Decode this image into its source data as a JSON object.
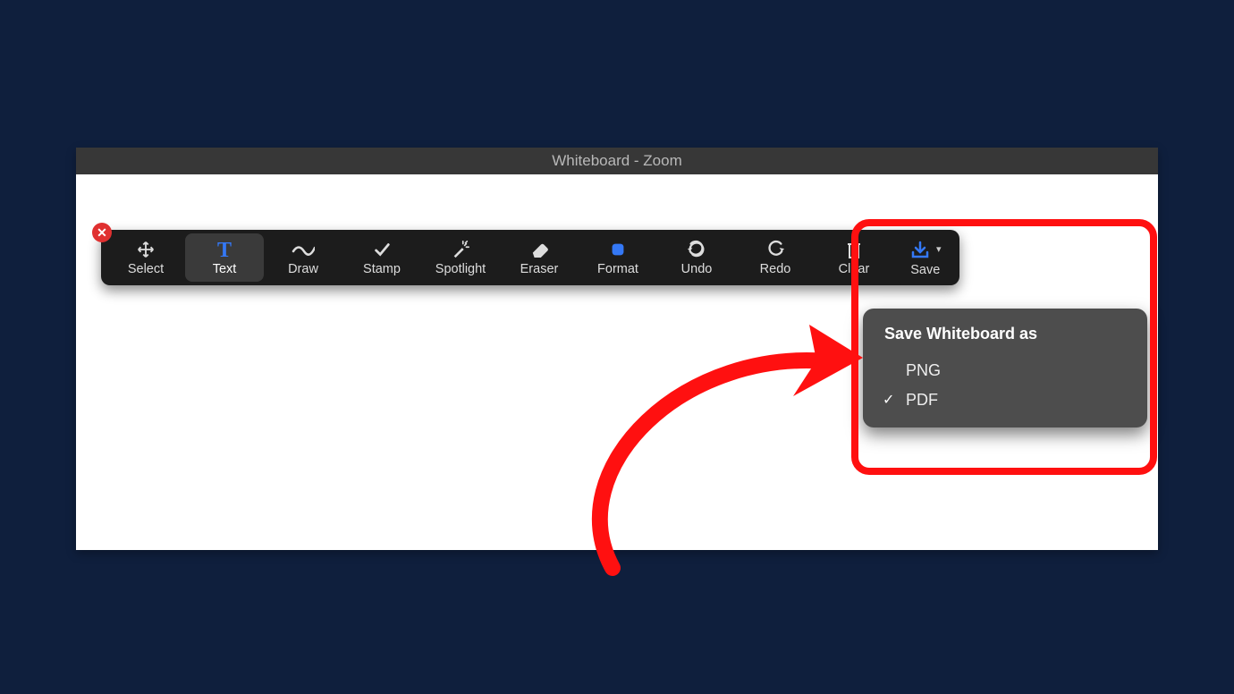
{
  "window": {
    "title": "Whiteboard - Zoom"
  },
  "toolbar": {
    "items": [
      {
        "id": "select",
        "label": "Select",
        "icon": "move-icon"
      },
      {
        "id": "text",
        "label": "Text",
        "icon": "text-icon",
        "active": true
      },
      {
        "id": "draw",
        "label": "Draw",
        "icon": "draw-icon"
      },
      {
        "id": "stamp",
        "label": "Stamp",
        "icon": "stamp-icon"
      },
      {
        "id": "spotlight",
        "label": "Spotlight",
        "icon": "spotlight-icon"
      },
      {
        "id": "eraser",
        "label": "Eraser",
        "icon": "eraser-icon"
      },
      {
        "id": "format",
        "label": "Format",
        "icon": "format-icon"
      },
      {
        "id": "undo",
        "label": "Undo",
        "icon": "undo-icon"
      },
      {
        "id": "redo",
        "label": "Redo",
        "icon": "redo-icon"
      },
      {
        "id": "clear",
        "label": "Clear",
        "icon": "trash-icon"
      }
    ],
    "save": {
      "label": "Save",
      "icon": "download-icon"
    }
  },
  "save_menu": {
    "title": "Save Whiteboard as",
    "options": [
      {
        "label": "PNG",
        "selected": false
      },
      {
        "label": "PDF",
        "selected": true
      }
    ]
  },
  "annotation": {
    "arrow_color": "#ff1010",
    "callout_color": "#ff1010"
  }
}
